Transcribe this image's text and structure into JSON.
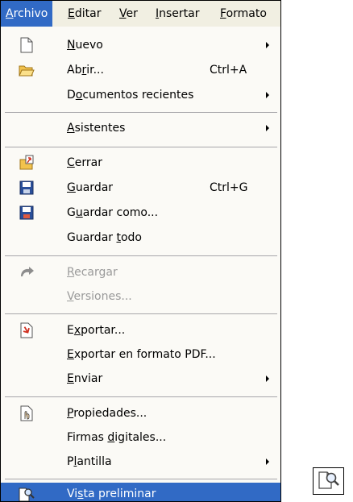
{
  "menubar": {
    "items": [
      {
        "pre": "",
        "u": "A",
        "post": "rchivo"
      },
      {
        "pre": "",
        "u": "E",
        "post": "ditar"
      },
      {
        "pre": "",
        "u": "V",
        "post": "er"
      },
      {
        "pre": "",
        "u": "I",
        "post": "nsertar"
      },
      {
        "pre": "",
        "u": "F",
        "post": "ormato"
      }
    ]
  },
  "menu": {
    "items": [
      {
        "pre": "",
        "u": "N",
        "post": "uevo",
        "shortcut": "",
        "icon": "new-document-icon"
      },
      {
        "pre": "Ab",
        "u": "r",
        "post": "ir...",
        "shortcut": "Ctrl+A",
        "icon": "open-folder-icon"
      },
      {
        "pre": "D",
        "u": "o",
        "post": "cumentos recientes",
        "shortcut": "",
        "icon": ""
      },
      {
        "pre": "",
        "u": "A",
        "post": "sistentes",
        "shortcut": "",
        "icon": ""
      },
      {
        "pre": "",
        "u": "C",
        "post": "errar",
        "shortcut": "",
        "icon": "close-document-icon"
      },
      {
        "pre": "",
        "u": "G",
        "post": "uardar",
        "shortcut": "Ctrl+G",
        "icon": "save-icon"
      },
      {
        "pre": "G",
        "u": "u",
        "post": "ardar como...",
        "shortcut": "",
        "icon": "save-as-icon"
      },
      {
        "pre": "Guardar ",
        "u": "t",
        "post": "odo",
        "shortcut": "",
        "icon": ""
      },
      {
        "pre": "",
        "u": "R",
        "post": "ecargar",
        "shortcut": "",
        "icon": "reload-icon"
      },
      {
        "pre": "",
        "u": "V",
        "post": "ersiones...",
        "shortcut": "",
        "icon": ""
      },
      {
        "pre": "E",
        "u": "x",
        "post": "portar...",
        "shortcut": "",
        "icon": "export-icon"
      },
      {
        "pre": "",
        "u": "E",
        "post": "xportar en formato PDF...",
        "shortcut": "",
        "icon": ""
      },
      {
        "pre": "",
        "u": "E",
        "post": "nviar",
        "shortcut": "",
        "icon": ""
      },
      {
        "pre": "",
        "u": "P",
        "post": "ropiedades...",
        "shortcut": "",
        "icon": "properties-icon"
      },
      {
        "pre": "Firmas ",
        "u": "d",
        "post": "igitales...",
        "shortcut": "",
        "icon": ""
      },
      {
        "pre": "P",
        "u": "l",
        "post": "antilla",
        "shortcut": "",
        "icon": ""
      },
      {
        "pre": "Vi",
        "u": "s",
        "post": "ta preliminar",
        "shortcut": "",
        "icon": "page-preview-icon"
      }
    ]
  },
  "colors": {
    "menubar_bg": "#f1efe2",
    "menu_bg": "#fbfaf6",
    "highlight": "#316ac5",
    "disabled_text": "#9a9a9a"
  }
}
